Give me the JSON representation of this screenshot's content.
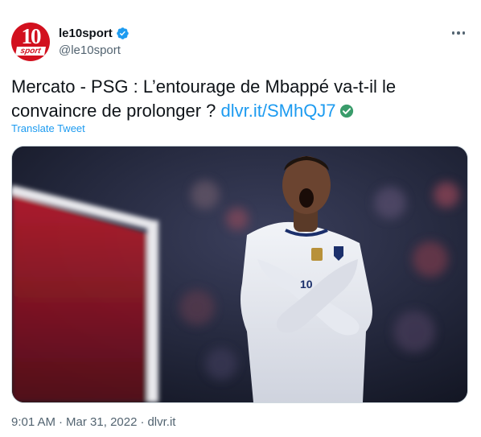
{
  "tweet": {
    "avatar": {
      "label_top": "10",
      "label_bottom": "sport",
      "color": "#d2101e"
    },
    "display_name": "le10sport",
    "verified": true,
    "handle": "@le10sport",
    "more_icon": "more-horizontal-icon",
    "text_before_link": "Mercato - PSG : L’entourage de Mbappé va-t-il le convaincre de prolonger ? ",
    "link_text": "dlvr.it/SMhQJ7",
    "translate_label": "Translate Tweet",
    "image": {
      "description_icon": "photo",
      "jersey_number": "10"
    },
    "time": "9:01 AM",
    "date": "Mar 31, 2022",
    "source": "dlvr.it",
    "separator": "·"
  },
  "colors": {
    "link": "#1d9bf0",
    "secondary_text": "#536471",
    "text": "#0f1419",
    "verified_badge": "#1d9bf0",
    "green_check": "#3a9c6b"
  }
}
